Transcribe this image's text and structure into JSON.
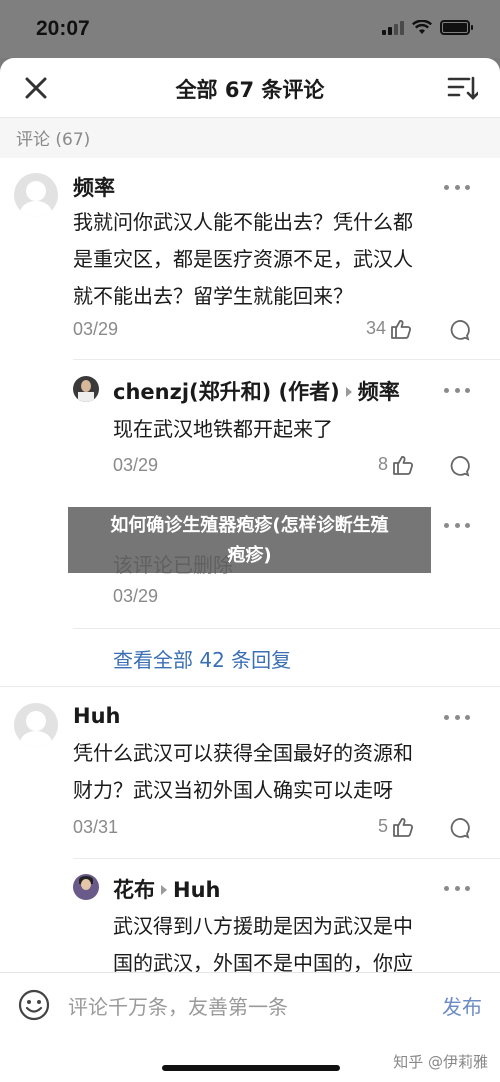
{
  "status_bar": {
    "time": "20:07"
  },
  "header": {
    "title": "全部 67 条评论"
  },
  "section_label": "评论 (67)",
  "comments": [
    {
      "author": "频率",
      "text_lines": [
        "我就问你武汉人能不能出去？凭什么都",
        "是重灾区，都是医疗资源不足，武汉人",
        "就不能出去？留学生就能回来？"
      ],
      "date": "03/29",
      "likes": "34",
      "replies": [
        {
          "author": "chenzj(郑升和) (作者)",
          "reply_to": "频率",
          "text": "现在武汉地铁都开起来了",
          "date": "03/29",
          "likes": "8"
        },
        {
          "text": "该评论已删除",
          "date": "03/29"
        }
      ],
      "view_all": "查看全部 42 条回复"
    },
    {
      "author": "Huh",
      "text_lines": [
        "凭什么武汉可以获得全国最好的资源和",
        "财力？武汉当初外国人确实可以走呀"
      ],
      "date": "03/31",
      "likes": "5",
      "replies": [
        {
          "author": "花布",
          "reply_to": "Huh",
          "text_lines": [
            "武汉得到八方援助是因为武汉是中",
            "国的武汉，外国不是中国的，你应"
          ]
        }
      ]
    }
  ],
  "banner": {
    "line1": "如何确诊生殖器疱疹(怎样诊断生殖",
    "line2": "疱疹)"
  },
  "composer": {
    "placeholder": "评论千万条，友善第一条",
    "send_label": "发布",
    "watermark": "知乎 @伊莉雅"
  }
}
